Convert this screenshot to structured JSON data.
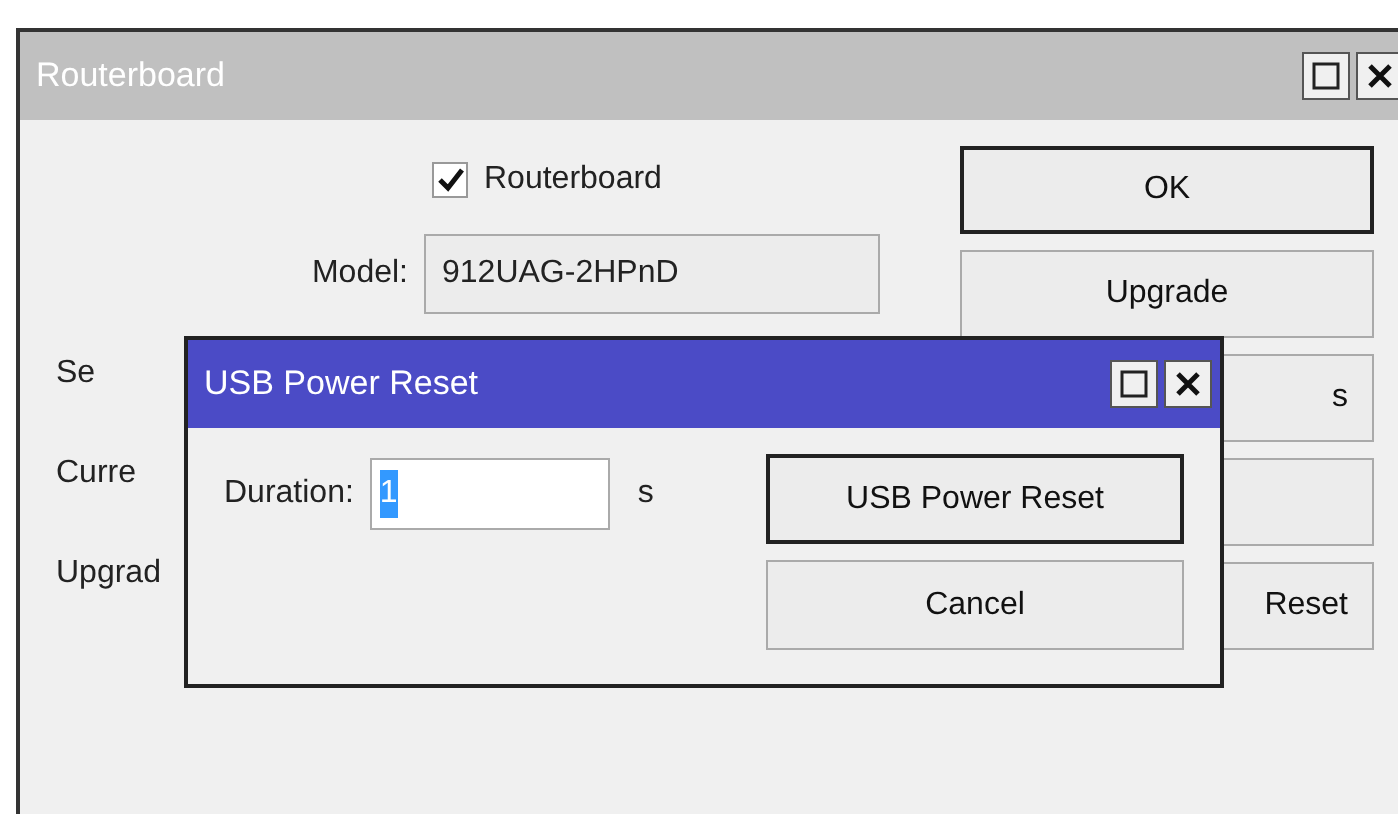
{
  "window": {
    "title": "Routerboard",
    "active": false
  },
  "checkbox": {
    "label": "Routerboard",
    "checked": true
  },
  "rows": [
    {
      "kind": "field",
      "label": "Model:",
      "value": "912UAG-2HPnD"
    },
    {
      "kind": "cut",
      "label": "Se"
    },
    {
      "kind": "cut",
      "label": "Curre"
    },
    {
      "kind": "cut",
      "label": "Upgrad"
    }
  ],
  "buttons": [
    {
      "label": "OK",
      "default": true
    },
    {
      "label": "Upgrade",
      "default": false
    },
    {
      "label": "s",
      "default": false
    },
    {
      "default": false
    },
    {
      "label": "Reset",
      "default": false
    }
  ],
  "dialog": {
    "title": "USB Power Reset",
    "active": true,
    "duration_label": "Duration:",
    "duration_value": "1",
    "unit": "s",
    "buttons": [
      {
        "label": "USB Power Reset",
        "default": true
      },
      {
        "label": "Cancel",
        "default": false
      }
    ]
  }
}
